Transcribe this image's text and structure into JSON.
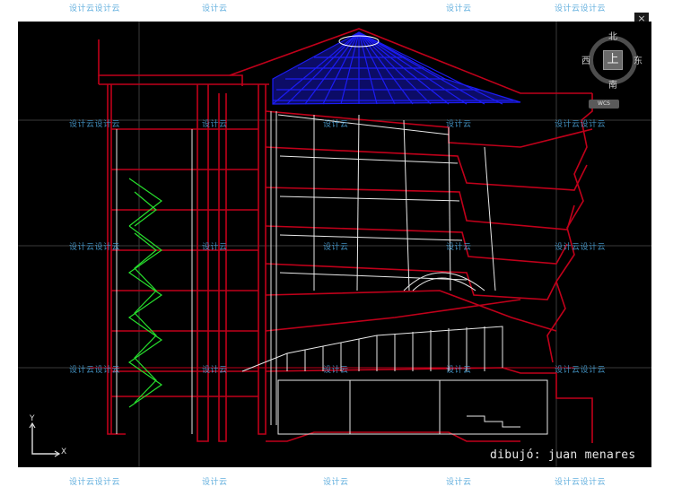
{
  "window": {
    "close_glyph": "×"
  },
  "watermarks": {
    "text": "设计云",
    "double_text": "设计云设计云"
  },
  "drawing": {
    "credit": "dibujó: juan menares",
    "colors": {
      "background": "#000000",
      "section_lines": "#c0001a",
      "geometry_lines": "#ffffff",
      "dome": "#1c1cf5",
      "stairs": "#27e02d"
    }
  },
  "viewcube": {
    "north": "北",
    "south": "南",
    "east": "东",
    "west": "西",
    "face": "上",
    "wcs_label": "WCS",
    "ring_icon": "compass-ring-icon"
  },
  "ucs": {
    "x_label": "X",
    "y_label": "Y"
  }
}
